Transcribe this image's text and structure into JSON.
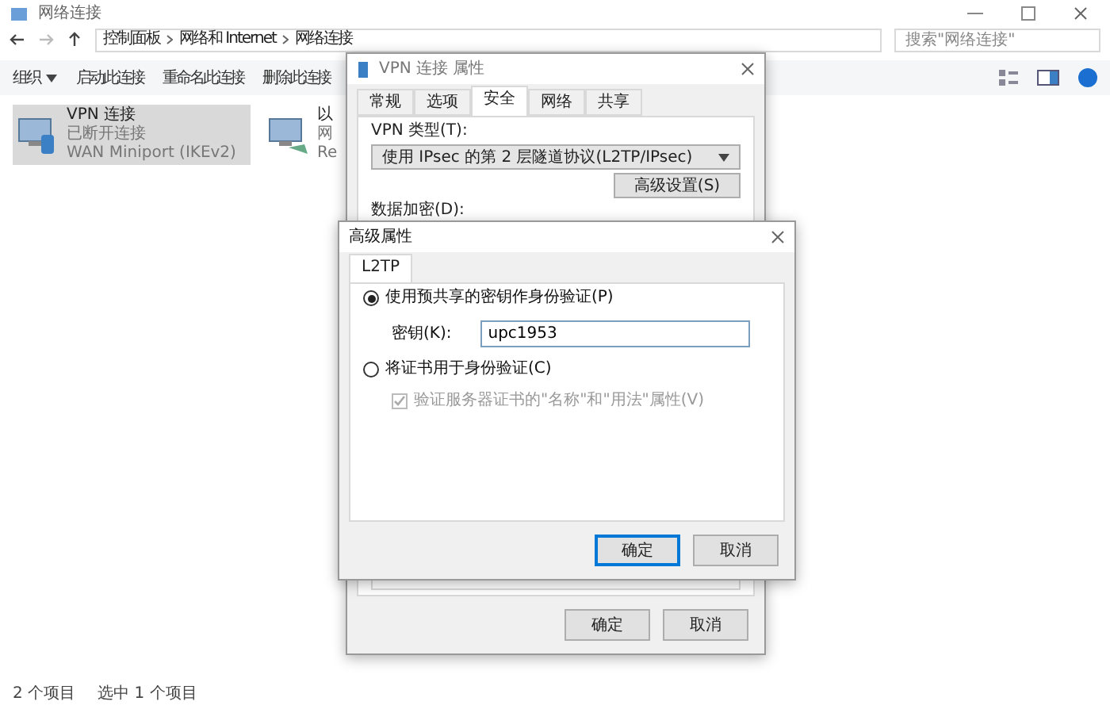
{
  "window": {
    "title": "网络连接"
  },
  "address_bar": {
    "crumbs": [
      "控制面板",
      "网络和 Internet",
      "网络连接"
    ]
  },
  "search": {
    "placeholder": "搜索\"网络连接\""
  },
  "toolbar": {
    "items": [
      {
        "label": "组织",
        "dropdown": true
      },
      {
        "label": "启动此连接",
        "dropdown": false
      },
      {
        "label": "重命名此连接",
        "dropdown": false
      },
      {
        "label": "删除此连接",
        "dropdown": false
      }
    ]
  },
  "connections": [
    {
      "name": "VPN 连接",
      "status": "已断开连接",
      "device": "WAN Miniport (IKEv2)",
      "selected": true,
      "kind": "vpn"
    },
    {
      "name": "以",
      "status": "网",
      "device": "Re",
      "selected": false,
      "kind": "ethernet"
    }
  ],
  "status_bar": {
    "count": "2 个项目",
    "selection": "选中 1 个项目"
  },
  "properties_dialog": {
    "title": "VPN 连接 属性",
    "tabs": [
      {
        "label": "常规",
        "selected": false
      },
      {
        "label": "选项",
        "selected": false
      },
      {
        "label": "安全",
        "selected": true
      },
      {
        "label": "网络",
        "selected": false
      },
      {
        "label": "共享",
        "selected": false
      }
    ],
    "vpn_type_label": "VPN 类型(T):",
    "vpn_type_value": "使用 IPsec 的第 2 层隧道协议(L2TP/IPsec)",
    "advanced_button": "高级设置(S)",
    "encryption_label": "数据加密(D):",
    "buttons": [
      {
        "label": "确定",
        "default": false
      },
      {
        "label": "取消",
        "default": false
      }
    ]
  },
  "advanced_dialog": {
    "title": "高级属性",
    "tabs": [
      {
        "label": "L2TP",
        "selected": true
      }
    ],
    "options": [
      {
        "kind": "radio",
        "label": "使用预共享的密钥作身份验证(P)",
        "selected": true,
        "disabled": false
      },
      {
        "kind": "key",
        "label": "密钥(K):",
        "value": "upc1953"
      },
      {
        "kind": "radio",
        "label": "将证书用于身份验证(C)",
        "selected": false,
        "disabled": false
      },
      {
        "kind": "checkbox",
        "label": "验证服务器证书的\"名称\"和\"用法\"属性(V)",
        "checked": true,
        "disabled": true
      }
    ],
    "buttons": [
      {
        "label": "确定",
        "default": true
      },
      {
        "label": "取消",
        "default": false
      }
    ]
  }
}
